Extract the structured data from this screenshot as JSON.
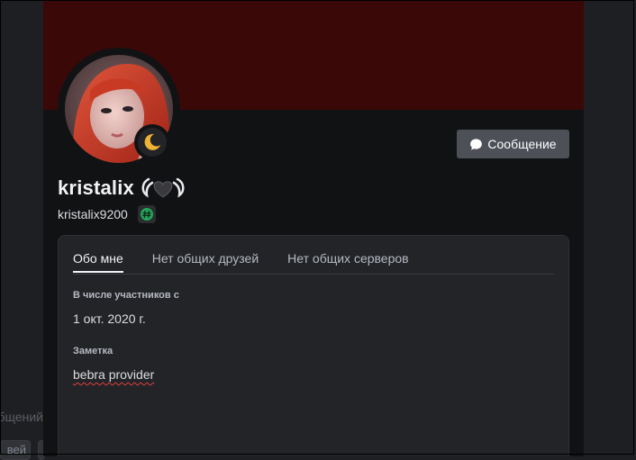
{
  "background": {
    "partial_text": "общений",
    "partial_chip_left": "вей"
  },
  "profile": {
    "banner_color": "#3b0808",
    "avatar_icon": "avatar-photo",
    "status": "idle",
    "status_icon": "crescent-moon-icon",
    "message_button": {
      "icon": "chat-bubble-icon",
      "label": "Сообщение"
    },
    "display_name": "kristalix",
    "display_name_decoration": "heart-with-wings-emoji",
    "username": "kristalix9200",
    "badge_icon": "hashtag-badge-icon",
    "tabs": [
      {
        "label": "Обо мне",
        "active": true
      },
      {
        "label": "Нет общих друзей",
        "active": false
      },
      {
        "label": "Нет общих серверов",
        "active": false
      }
    ],
    "member_since": {
      "title": "В числе участников с",
      "value": "1 окт. 2020 г."
    },
    "note": {
      "title": "Заметка",
      "value": "bebra provider"
    }
  }
}
